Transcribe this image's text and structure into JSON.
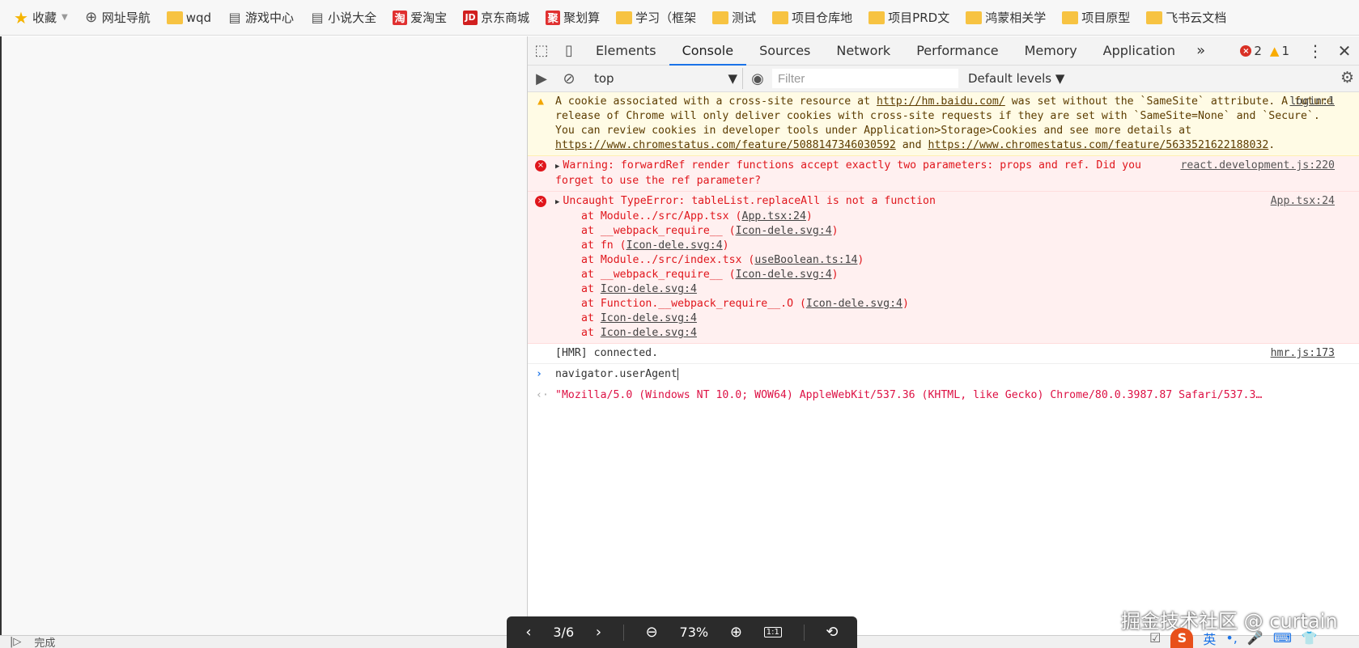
{
  "bookmarks": [
    {
      "label": "收藏",
      "icon": "star-icon"
    },
    {
      "label": "网址导航",
      "icon": "globe-icon"
    },
    {
      "label": "wqd",
      "icon": "folder-icon"
    },
    {
      "label": "游戏中心",
      "icon": "doc-icon"
    },
    {
      "label": "小说大全",
      "icon": "doc-icon"
    },
    {
      "label": "爱淘宝",
      "icon": "taobao-icon",
      "glyph": "淘"
    },
    {
      "label": "京东商城",
      "icon": "jd-icon",
      "glyph": "JD"
    },
    {
      "label": "聚划算",
      "icon": "juhuasuan-icon",
      "glyph": "聚"
    },
    {
      "label": "学习（框架",
      "icon": "folder-icon"
    },
    {
      "label": "测试",
      "icon": "folder-icon"
    },
    {
      "label": "项目仓库地",
      "icon": "folder-icon"
    },
    {
      "label": "项目PRD文",
      "icon": "folder-icon"
    },
    {
      "label": "鸿蒙相关学",
      "icon": "folder-icon"
    },
    {
      "label": "项目原型",
      "icon": "folder-icon"
    },
    {
      "label": "飞书云文档",
      "icon": "folder-icon"
    }
  ],
  "devtools": {
    "tabs": [
      "Elements",
      "Console",
      "Sources",
      "Network",
      "Performance",
      "Memory",
      "Application"
    ],
    "active_tab": "Console",
    "more_label": "»",
    "error_count": "2",
    "warning_count": "1",
    "context": "top",
    "filter_placeholder": "Filter",
    "levels_label": "Default levels ▼"
  },
  "console": {
    "warning": {
      "text_1": "A cookie associated with a cross-site resource at ",
      "link_1": "http://hm.baidu.com/",
      "text_2": " was set without the `SameSite` attribute. A future release of Chrome will only deliver cookies with cross-site requests if they are set with `SameSite=None` and `Secure`. You can review cookies in developer tools under Application>Storage>Cookies and see more details at ",
      "link_2": "https://www.chromestatus.com/feature/5088147346030592",
      "text_3": " and ",
      "link_3": "https://www.chromestatus.com/feature/5633521622188032",
      "text_4": ".",
      "source": "login:1"
    },
    "error_1": {
      "text": "Warning: forwardRef render functions accept exactly two parameters: props and ref. Did you forget to use the ref parameter?",
      "source": "react.development.js:220"
    },
    "error_2": {
      "text": "Uncaught TypeError: tableList.replaceAll is not a function",
      "source": "App.tsx:24",
      "stack": [
        {
          "prefix": "at Module../src/App.tsx (",
          "link": "App.tsx:24",
          "suffix": ")"
        },
        {
          "prefix": "at __webpack_require__ (",
          "link": "Icon-dele.svg:4",
          "suffix": ")"
        },
        {
          "prefix": "at fn (",
          "link": "Icon-dele.svg:4",
          "suffix": ")"
        },
        {
          "prefix": "at Module../src/index.tsx (",
          "link": "useBoolean.ts:14",
          "suffix": ")"
        },
        {
          "prefix": "at __webpack_require__ (",
          "link": "Icon-dele.svg:4",
          "suffix": ")"
        },
        {
          "prefix": "at ",
          "link": "Icon-dele.svg:4",
          "suffix": ""
        },
        {
          "prefix": "at Function.__webpack_require__.O (",
          "link": "Icon-dele.svg:4",
          "suffix": ")"
        },
        {
          "prefix": "at ",
          "link": "Icon-dele.svg:4",
          "suffix": ""
        },
        {
          "prefix": "at ",
          "link": "Icon-dele.svg:4",
          "suffix": ""
        }
      ]
    },
    "log": {
      "text": "[HMR] connected.",
      "source": "hmr.js:173"
    },
    "input": "navigator.userAgent",
    "result": "\"Mozilla/5.0 (Windows NT 10.0; WOW64) AppleWebKit/537.36 (KHTML, like Gecko) Chrome/80.0.3987.87 Safari/537.3…"
  },
  "statusbar": {
    "text": "完成"
  },
  "viewer": {
    "page": "3/6",
    "zoom": "73%",
    "one_to_one": "1:1"
  },
  "credit": "掘金技术社区 @ curtain",
  "tray": {
    "ime_label": "英"
  }
}
